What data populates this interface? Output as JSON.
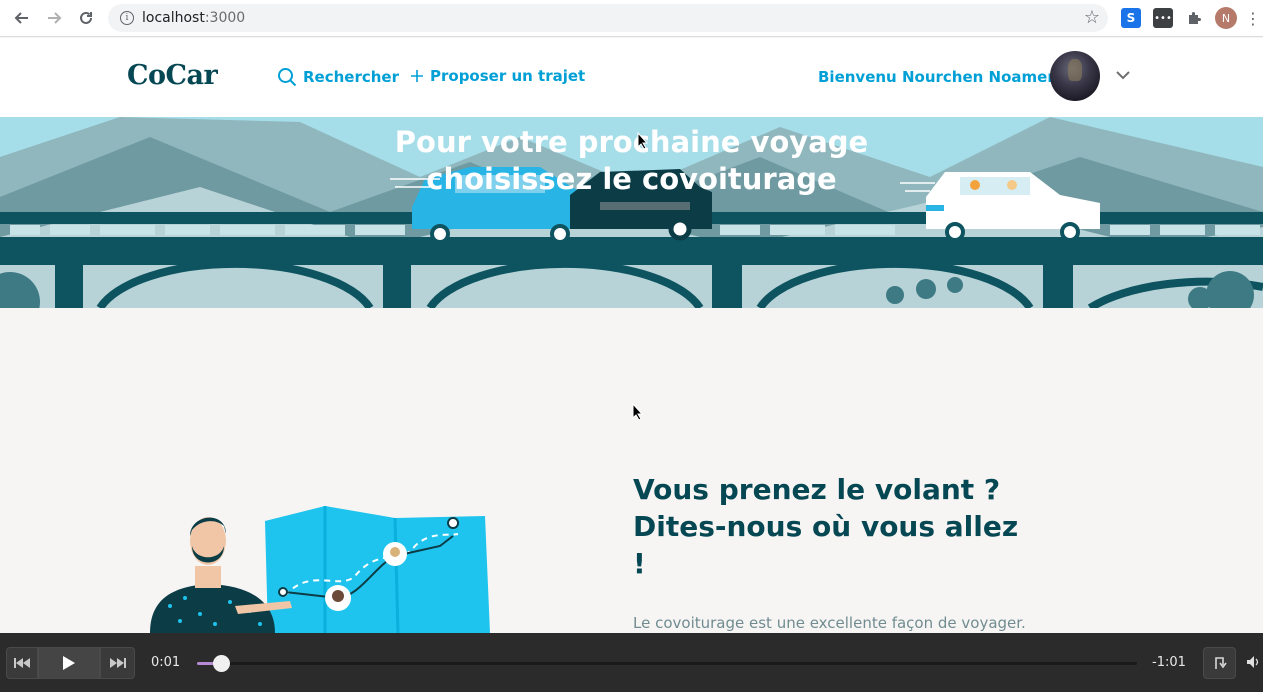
{
  "browser": {
    "url_host": "localhost",
    "url_port": ":3000",
    "profile_initial": "N",
    "ext_s_label": "S"
  },
  "header": {
    "logo": "CoCar",
    "nav": {
      "search_label": "Rechercher",
      "propose_label": "Proposer un trajet"
    },
    "welcome": "Bienvenu Nourchen Noamen"
  },
  "hero": {
    "line1": "Pour votre prochaine voyage",
    "line2": "choisissez le covoiturage"
  },
  "section": {
    "headline_line1": "Vous prenez le volant ?",
    "headline_line2": "Dites-nous où vous allez",
    "headline_line3": "!",
    "paragraph": "Le covoiturage est une excellente façon de voyager. C'est"
  },
  "player": {
    "current_time": "0:01",
    "remaining_time": "-1:01",
    "progress": 0.025
  },
  "colors": {
    "brand_dark": "#054752",
    "link": "#00a0d6",
    "hero_sky": "#a5dde8",
    "page_bg": "#f7f5f4"
  }
}
